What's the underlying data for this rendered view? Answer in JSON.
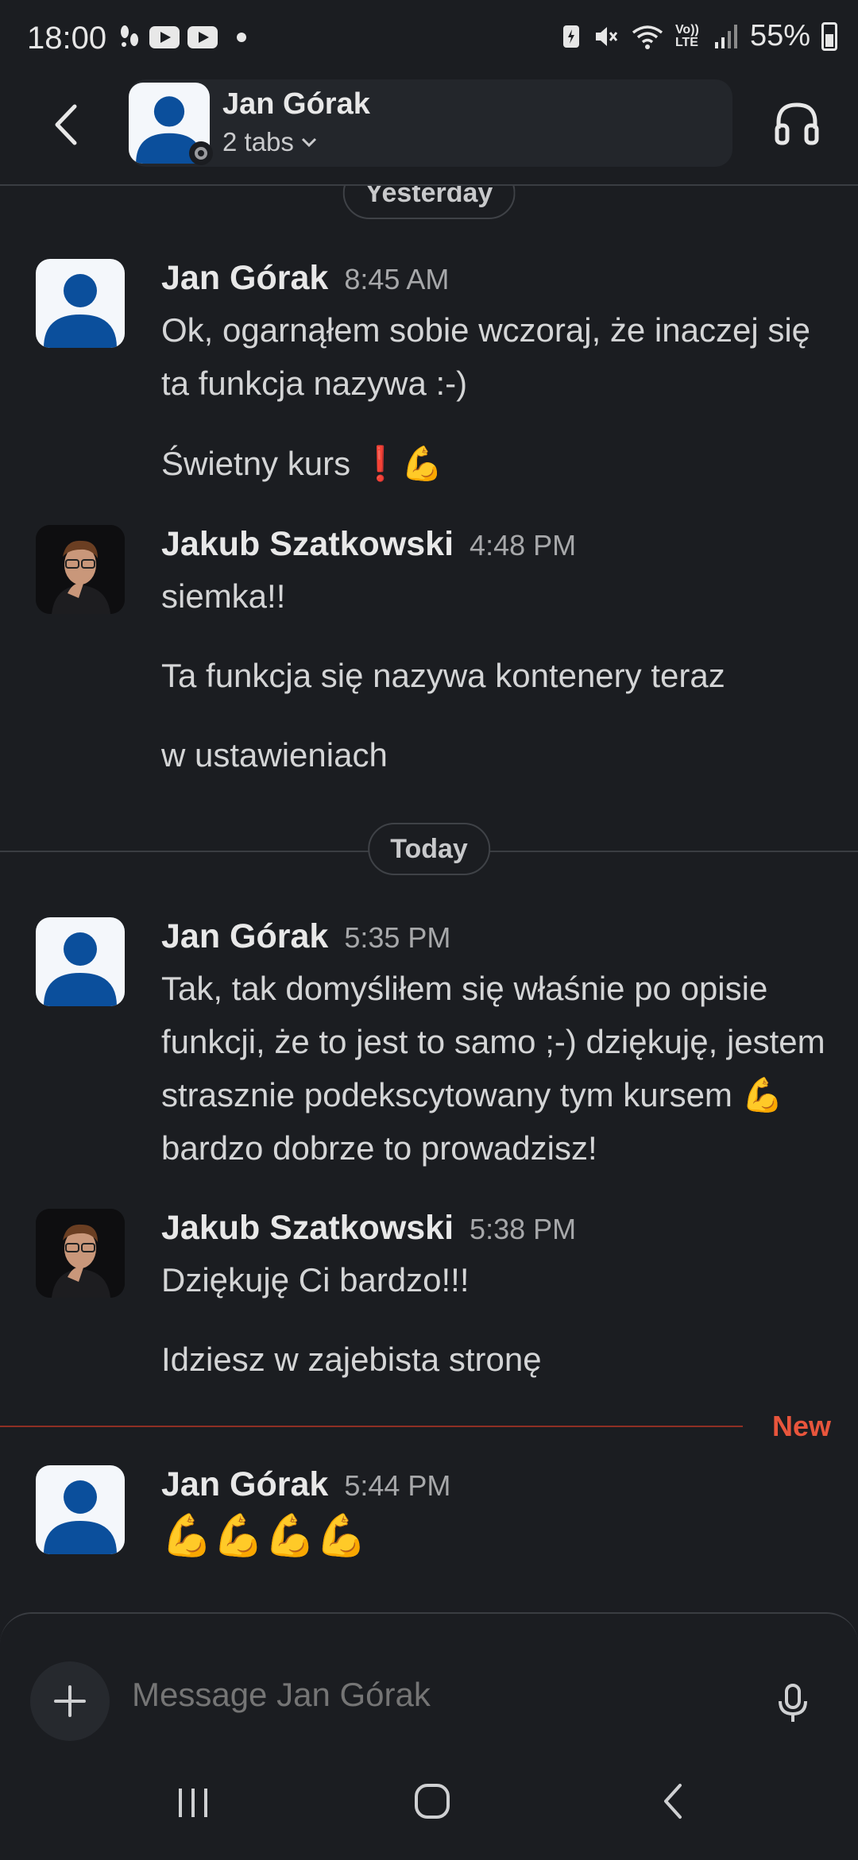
{
  "status_bar": {
    "time": "18:00",
    "volte": "Vo)) LTE",
    "battery": "55%"
  },
  "header": {
    "name": "Jan Górak",
    "subtitle": "2 tabs"
  },
  "dividers": {
    "yesterday": "Yesterday",
    "today": "Today",
    "new": "New"
  },
  "messages": [
    {
      "author": "Jan Górak",
      "time": "8:45 AM",
      "lines": [
        "Ok, ogarnąłem sobie wczoraj, że inaczej się ta funkcja nazywa :-)",
        "Świetny kurs ❗💪"
      ]
    },
    {
      "author": "Jakub Szatkowski",
      "time": "4:48 PM",
      "lines": [
        "siemka!!",
        "Ta funkcja się nazywa kontenery teraz",
        "w ustawieniach"
      ]
    },
    {
      "author": "Jan Górak",
      "time": "5:35 PM",
      "lines": [
        "Tak, tak domyśliłem się właśnie po opisie funkcji, że to jest to samo ;-) dziękuję, jestem strasznie podekscytowany tym kursem 💪bardzo dobrze to prowadzisz!"
      ]
    },
    {
      "author": "Jakub Szatkowski",
      "time": "5:38 PM",
      "lines": [
        "Dziękuję Ci bardzo!!!",
        "Idziesz w zajebista stronę"
      ]
    },
    {
      "author": "Jan Górak",
      "time": "5:44 PM",
      "lines": [
        "💪💪💪💪"
      ]
    }
  ],
  "composer": {
    "placeholder": "Message Jan Górak"
  },
  "colors": {
    "background": "#1b1d21",
    "new_marker": "#e8553c",
    "avatar_blue": "#0b4f9c"
  }
}
